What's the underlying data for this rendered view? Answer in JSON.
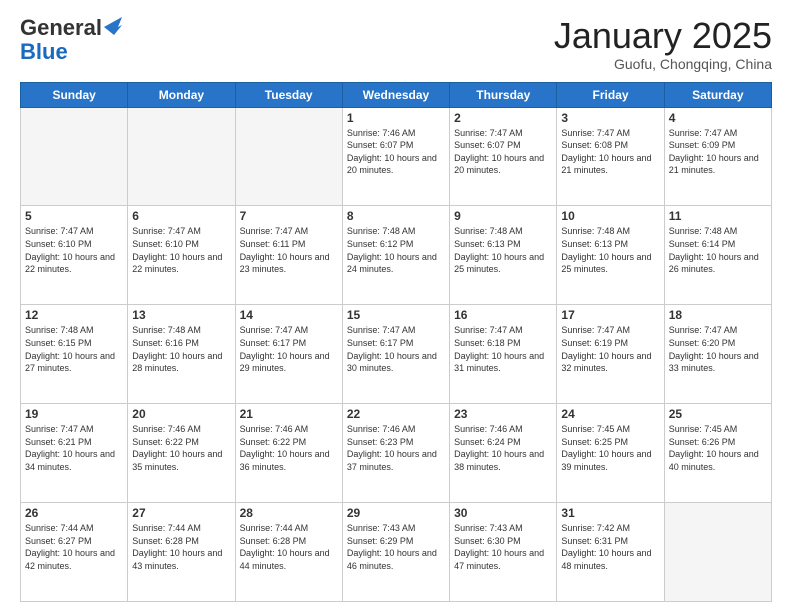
{
  "header": {
    "logo_line1": "General",
    "logo_line2": "Blue",
    "month": "January 2025",
    "location": "Guofu, Chongqing, China"
  },
  "weekdays": [
    "Sunday",
    "Monday",
    "Tuesday",
    "Wednesday",
    "Thursday",
    "Friday",
    "Saturday"
  ],
  "weeks": [
    [
      {
        "day": "",
        "info": ""
      },
      {
        "day": "",
        "info": ""
      },
      {
        "day": "",
        "info": ""
      },
      {
        "day": "1",
        "info": "Sunrise: 7:46 AM\nSunset: 6:07 PM\nDaylight: 10 hours and 20 minutes."
      },
      {
        "day": "2",
        "info": "Sunrise: 7:47 AM\nSunset: 6:07 PM\nDaylight: 10 hours and 20 minutes."
      },
      {
        "day": "3",
        "info": "Sunrise: 7:47 AM\nSunset: 6:08 PM\nDaylight: 10 hours and 21 minutes."
      },
      {
        "day": "4",
        "info": "Sunrise: 7:47 AM\nSunset: 6:09 PM\nDaylight: 10 hours and 21 minutes."
      }
    ],
    [
      {
        "day": "5",
        "info": "Sunrise: 7:47 AM\nSunset: 6:10 PM\nDaylight: 10 hours and 22 minutes."
      },
      {
        "day": "6",
        "info": "Sunrise: 7:47 AM\nSunset: 6:10 PM\nDaylight: 10 hours and 22 minutes."
      },
      {
        "day": "7",
        "info": "Sunrise: 7:47 AM\nSunset: 6:11 PM\nDaylight: 10 hours and 23 minutes."
      },
      {
        "day": "8",
        "info": "Sunrise: 7:48 AM\nSunset: 6:12 PM\nDaylight: 10 hours and 24 minutes."
      },
      {
        "day": "9",
        "info": "Sunrise: 7:48 AM\nSunset: 6:13 PM\nDaylight: 10 hours and 25 minutes."
      },
      {
        "day": "10",
        "info": "Sunrise: 7:48 AM\nSunset: 6:13 PM\nDaylight: 10 hours and 25 minutes."
      },
      {
        "day": "11",
        "info": "Sunrise: 7:48 AM\nSunset: 6:14 PM\nDaylight: 10 hours and 26 minutes."
      }
    ],
    [
      {
        "day": "12",
        "info": "Sunrise: 7:48 AM\nSunset: 6:15 PM\nDaylight: 10 hours and 27 minutes."
      },
      {
        "day": "13",
        "info": "Sunrise: 7:48 AM\nSunset: 6:16 PM\nDaylight: 10 hours and 28 minutes."
      },
      {
        "day": "14",
        "info": "Sunrise: 7:47 AM\nSunset: 6:17 PM\nDaylight: 10 hours and 29 minutes."
      },
      {
        "day": "15",
        "info": "Sunrise: 7:47 AM\nSunset: 6:17 PM\nDaylight: 10 hours and 30 minutes."
      },
      {
        "day": "16",
        "info": "Sunrise: 7:47 AM\nSunset: 6:18 PM\nDaylight: 10 hours and 31 minutes."
      },
      {
        "day": "17",
        "info": "Sunrise: 7:47 AM\nSunset: 6:19 PM\nDaylight: 10 hours and 32 minutes."
      },
      {
        "day": "18",
        "info": "Sunrise: 7:47 AM\nSunset: 6:20 PM\nDaylight: 10 hours and 33 minutes."
      }
    ],
    [
      {
        "day": "19",
        "info": "Sunrise: 7:47 AM\nSunset: 6:21 PM\nDaylight: 10 hours and 34 minutes."
      },
      {
        "day": "20",
        "info": "Sunrise: 7:46 AM\nSunset: 6:22 PM\nDaylight: 10 hours and 35 minutes."
      },
      {
        "day": "21",
        "info": "Sunrise: 7:46 AM\nSunset: 6:22 PM\nDaylight: 10 hours and 36 minutes."
      },
      {
        "day": "22",
        "info": "Sunrise: 7:46 AM\nSunset: 6:23 PM\nDaylight: 10 hours and 37 minutes."
      },
      {
        "day": "23",
        "info": "Sunrise: 7:46 AM\nSunset: 6:24 PM\nDaylight: 10 hours and 38 minutes."
      },
      {
        "day": "24",
        "info": "Sunrise: 7:45 AM\nSunset: 6:25 PM\nDaylight: 10 hours and 39 minutes."
      },
      {
        "day": "25",
        "info": "Sunrise: 7:45 AM\nSunset: 6:26 PM\nDaylight: 10 hours and 40 minutes."
      }
    ],
    [
      {
        "day": "26",
        "info": "Sunrise: 7:44 AM\nSunset: 6:27 PM\nDaylight: 10 hours and 42 minutes."
      },
      {
        "day": "27",
        "info": "Sunrise: 7:44 AM\nSunset: 6:28 PM\nDaylight: 10 hours and 43 minutes."
      },
      {
        "day": "28",
        "info": "Sunrise: 7:44 AM\nSunset: 6:28 PM\nDaylight: 10 hours and 44 minutes."
      },
      {
        "day": "29",
        "info": "Sunrise: 7:43 AM\nSunset: 6:29 PM\nDaylight: 10 hours and 46 minutes."
      },
      {
        "day": "30",
        "info": "Sunrise: 7:43 AM\nSunset: 6:30 PM\nDaylight: 10 hours and 47 minutes."
      },
      {
        "day": "31",
        "info": "Sunrise: 7:42 AM\nSunset: 6:31 PM\nDaylight: 10 hours and 48 minutes."
      },
      {
        "day": "",
        "info": ""
      }
    ]
  ]
}
